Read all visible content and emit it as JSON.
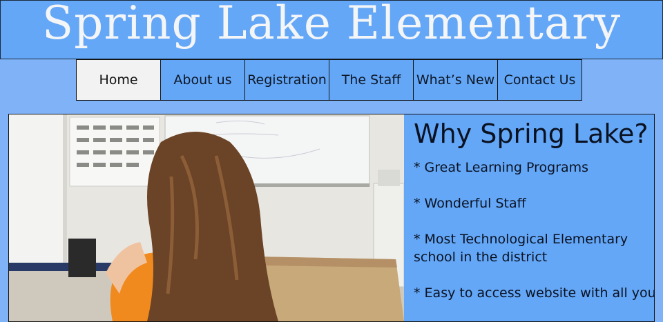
{
  "header": {
    "title": "Spring Lake Elementary"
  },
  "nav": {
    "items": [
      "Home",
      "About us",
      "Registration",
      "The Staff",
      "What’s New",
      "Contact Us"
    ],
    "active": "Home"
  },
  "main": {
    "photo_alt": "Student sitting at a desk in a classroom",
    "sidebar": {
      "heading": "Why Spring Lake?",
      "points": [
        "* Great Learning Programs",
        "* Wonderful Staff",
        "* Most Technological Elementary",
        "school in the district",
        "* Easy to access website with all your"
      ]
    }
  },
  "colors": {
    "header_bg": "#64a7f7",
    "page_bg": "#7fb2f7",
    "title": "#f3f5f7"
  }
}
